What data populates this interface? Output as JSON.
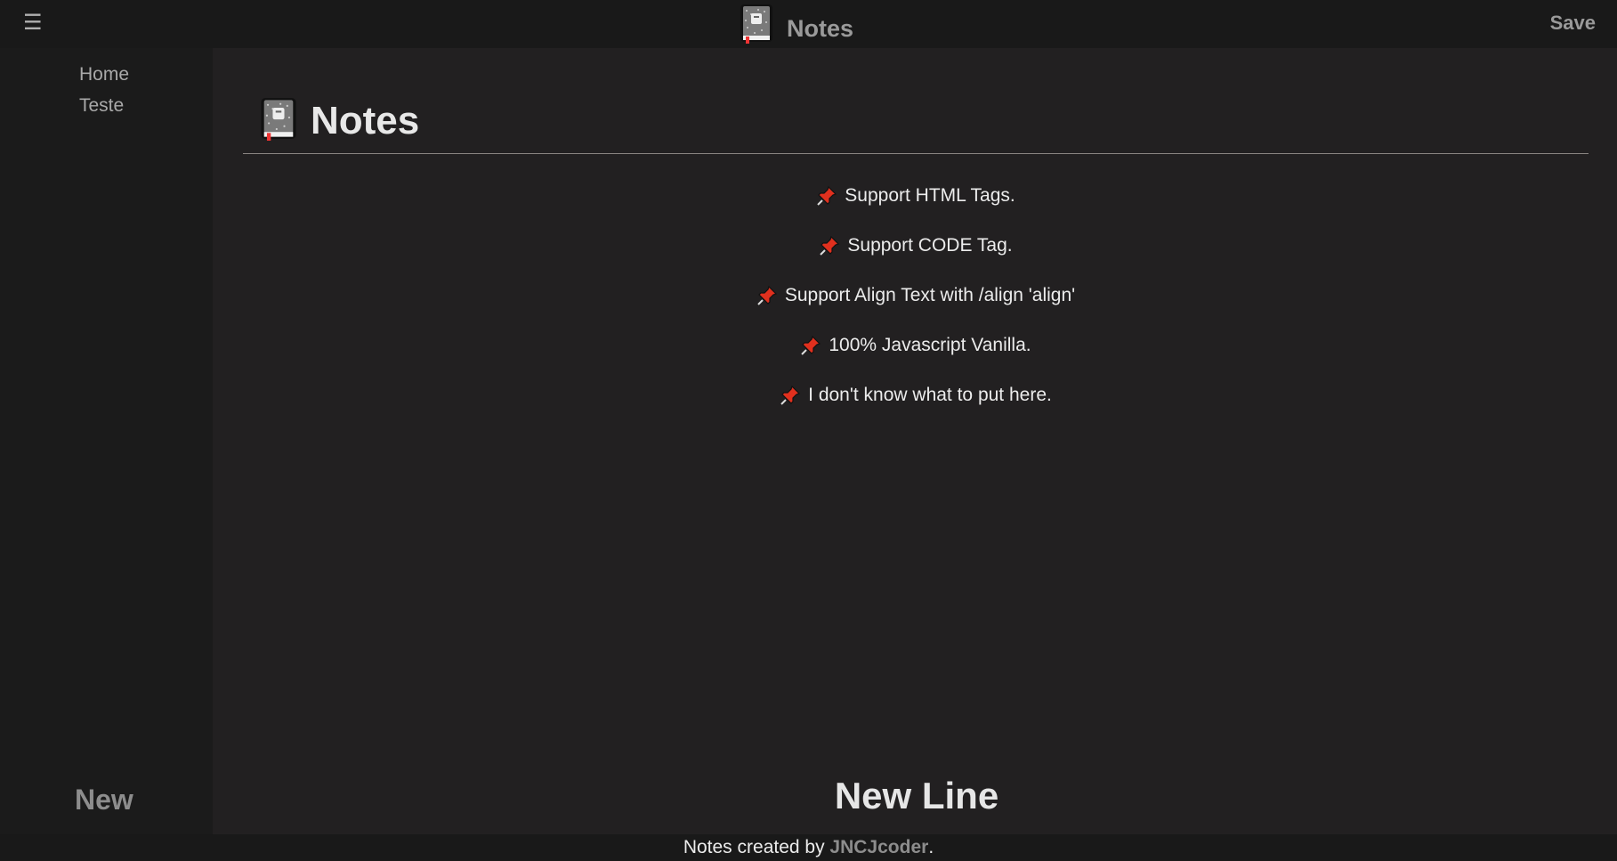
{
  "header": {
    "menu_icon": "hamburger-icon",
    "menu_glyph": "☰",
    "title": "Notes",
    "save_label": "Save"
  },
  "sidebar": {
    "items": [
      {
        "label": "Home"
      },
      {
        "label": "Teste"
      }
    ],
    "new_label": "New"
  },
  "main": {
    "page_title": "Notes",
    "notes": [
      {
        "icon": "pushpin-icon",
        "text": "Support HTML Tags."
      },
      {
        "icon": "pushpin-icon",
        "text": "Support CODE Tag."
      },
      {
        "icon": "pushpin-icon",
        "text": "Support Align Text with /align 'align'"
      },
      {
        "icon": "pushpin-icon",
        "text": "100% Javascript Vanilla."
      },
      {
        "icon": "pushpin-icon",
        "text": "I don't know what to put here."
      }
    ],
    "new_line_label": "New Line"
  },
  "footer": {
    "prefix": "Notes created by ",
    "author": "JNCJcoder",
    "suffix": "."
  },
  "colors": {
    "background": "#222021",
    "sidebar": "#1b1b1b",
    "topbar": "#191919",
    "pin_red": "#e0301e"
  }
}
